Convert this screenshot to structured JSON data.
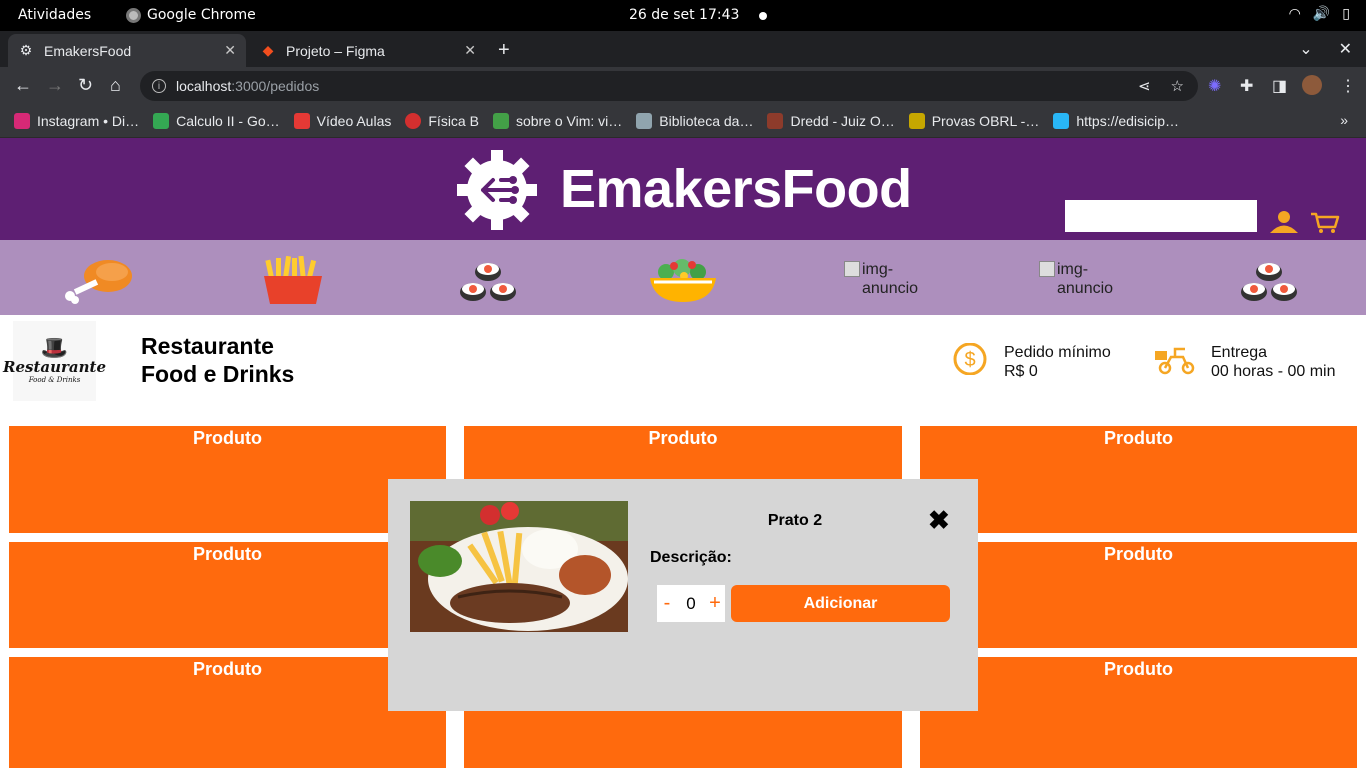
{
  "os_topbar": {
    "activities": "Atividades",
    "app_name": "Google Chrome",
    "clock": "26 de set  17:43"
  },
  "browser": {
    "tabs": [
      {
        "title": "EmakersFood",
        "active": true
      },
      {
        "title": "Projeto – Figma",
        "active": false
      }
    ],
    "url_host": "localhost",
    "url_path": ":3000/pedidos",
    "bookmarks": [
      {
        "label": "Instagram • Di…",
        "color": "#d62976"
      },
      {
        "label": "Calculo II - Go…",
        "color": "#34a853"
      },
      {
        "label": "Vídeo Aulas",
        "color": "#e53935"
      },
      {
        "label": "Física B",
        "color": "#d32f2f"
      },
      {
        "label": "sobre o Vim: vi…",
        "color": "#43a047"
      },
      {
        "label": "Biblioteca da…",
        "color": "#90a4ae"
      },
      {
        "label": "Dredd - Juiz O…",
        "color": "#8d3b2b"
      },
      {
        "label": "Provas OBRL -…",
        "color": "#c6a700"
      },
      {
        "label": "https://edisicip…",
        "color": "#29b6f6"
      }
    ]
  },
  "header": {
    "brand": "EmakersFood",
    "search_placeholder": ""
  },
  "categories": {
    "broken_alt": "img-anuncio"
  },
  "restaurant": {
    "logo_line1": "Restaurante",
    "logo_line2": "Food & Drinks",
    "name_line1": "Restaurante",
    "name_line2": "Food e Drinks",
    "min_order_label": "Pedido mínimo",
    "min_order_value": "R$ 0",
    "delivery_label": "Entrega",
    "delivery_value": "00 horas - 00 min"
  },
  "products": {
    "card_label": "Produto"
  },
  "modal": {
    "title": "Prato 2",
    "description_label": "Descrição:",
    "minus": "-",
    "quantity": "0",
    "plus": "+",
    "add_label": "Adicionar",
    "close_glyph": "✖"
  },
  "colors": {
    "header_bg": "#5e1f73",
    "category_bg": "#ad8fbd",
    "accent_orange": "#ff6a0d",
    "modal_bg": "#d6d6d6"
  }
}
